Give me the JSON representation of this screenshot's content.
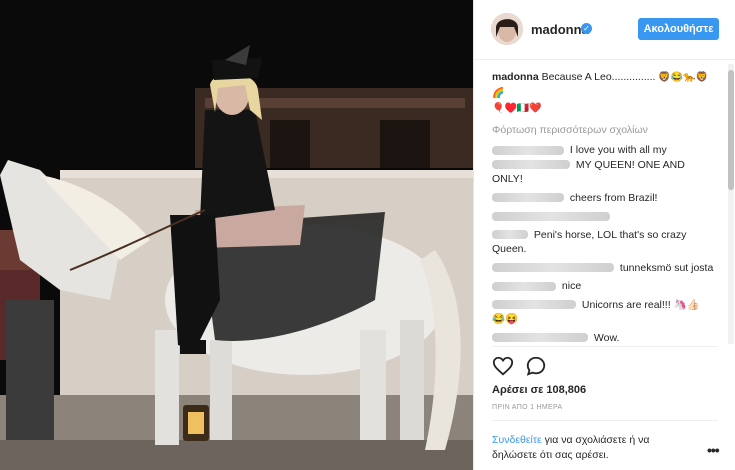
{
  "header": {
    "username": "madonna",
    "verified_icon": "✓",
    "follow_label": "Ακολουθήστε"
  },
  "caption": {
    "user": "madonna",
    "text": "Because A Leo...............",
    "emoji_line1": "🦁😂🐆🦁🌈",
    "emoji_line2": "🎈♥️🇮🇹❤️"
  },
  "load_more": "Φόρτωση περισσότερων σχολίων",
  "comments": [
    {
      "text": "I love you with all my",
      "text2": "MY QUEEN! ONE AND ONLY!"
    },
    {
      "text": "cheers from Brazil!"
    },
    {
      "text": "Peni's horse, LOL that's so crazy Queen."
    },
    {
      "text": "tunneksmö sut josta"
    },
    {
      "text": "nice"
    },
    {
      "text": "Unicorns are real!!! 🦄👍🏻",
      "text2": "😂😝"
    },
    {
      "text": "Wow."
    }
  ],
  "actions": {
    "like_icon": "heart-icon",
    "comment_icon": "comment-icon"
  },
  "likes": "Αρέσει σε 108,806",
  "time": "ΠΡΙΝ ΑΠΟ 1 ΗΜΕΡΑ",
  "login": {
    "link": "Συνδεθείτε",
    "rest": " για να σχολιάσετε ή να δηλώσετε ότι σας αρέσει."
  },
  "more_icon": "•••",
  "colors": {
    "accent": "#3897f0",
    "text": "#262626",
    "muted": "#999999"
  }
}
